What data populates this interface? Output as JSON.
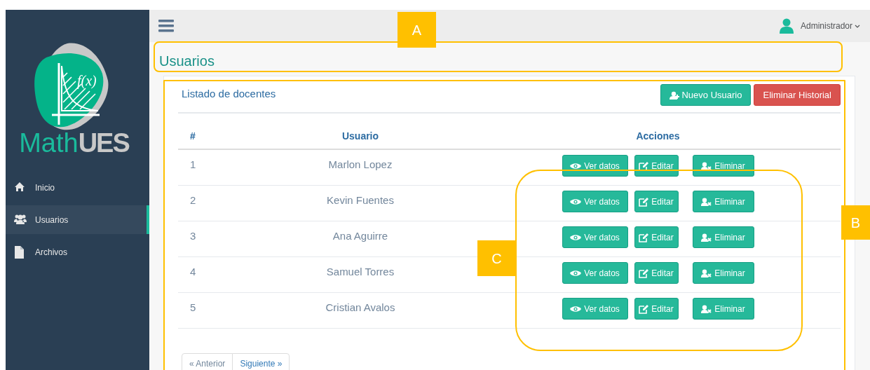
{
  "sidebar": {
    "logo": {
      "formula": "f(x)",
      "name_first": "Math",
      "name_second": "UES"
    },
    "items": [
      {
        "label": "Inicio",
        "kind": "home",
        "selected": false
      },
      {
        "label": "Usuarios",
        "kind": "users",
        "selected": true
      },
      {
        "label": "Archivos",
        "kind": "file",
        "selected": false
      }
    ]
  },
  "top_bar": {
    "user": "Administrador"
  },
  "page_title": "Usuarios",
  "panel": {
    "title": "Listado de docentes",
    "buttons": [
      {
        "label": "Nuevo Usuario",
        "kind": "primary"
      },
      {
        "label": "Eliminar Historial",
        "kind": "danger"
      }
    ],
    "table": {
      "columns": [
        "#",
        "Usuario",
        "Acciones"
      ],
      "rows": [
        {
          "number": "1",
          "user": "Marlon Lopez",
          "actions": [
            "Ver datos",
            "Editar",
            "Eliminar"
          ]
        },
        {
          "number": "2",
          "user": "Kevin Fuentes",
          "actions": [
            "Ver datos",
            "Editar",
            "Eliminar"
          ]
        },
        {
          "number": "3",
          "user": "Ana Aguirre",
          "actions": [
            "Ver datos",
            "Editar",
            "Eliminar"
          ]
        },
        {
          "number": "4",
          "user": "Samuel Torres",
          "actions": [
            "Ver datos",
            "Editar",
            "Eliminar"
          ]
        },
        {
          "number": "5",
          "user": "Cristian Avalos",
          "actions": [
            "Ver datos",
            "Editar",
            "Eliminar"
          ]
        }
      ]
    },
    "pagination": [
      "« Anterior",
      "Siguiente »"
    ]
  },
  "annotations": [
    {
      "label": "A"
    },
    {
      "label": "B"
    },
    {
      "label": "C"
    }
  ]
}
